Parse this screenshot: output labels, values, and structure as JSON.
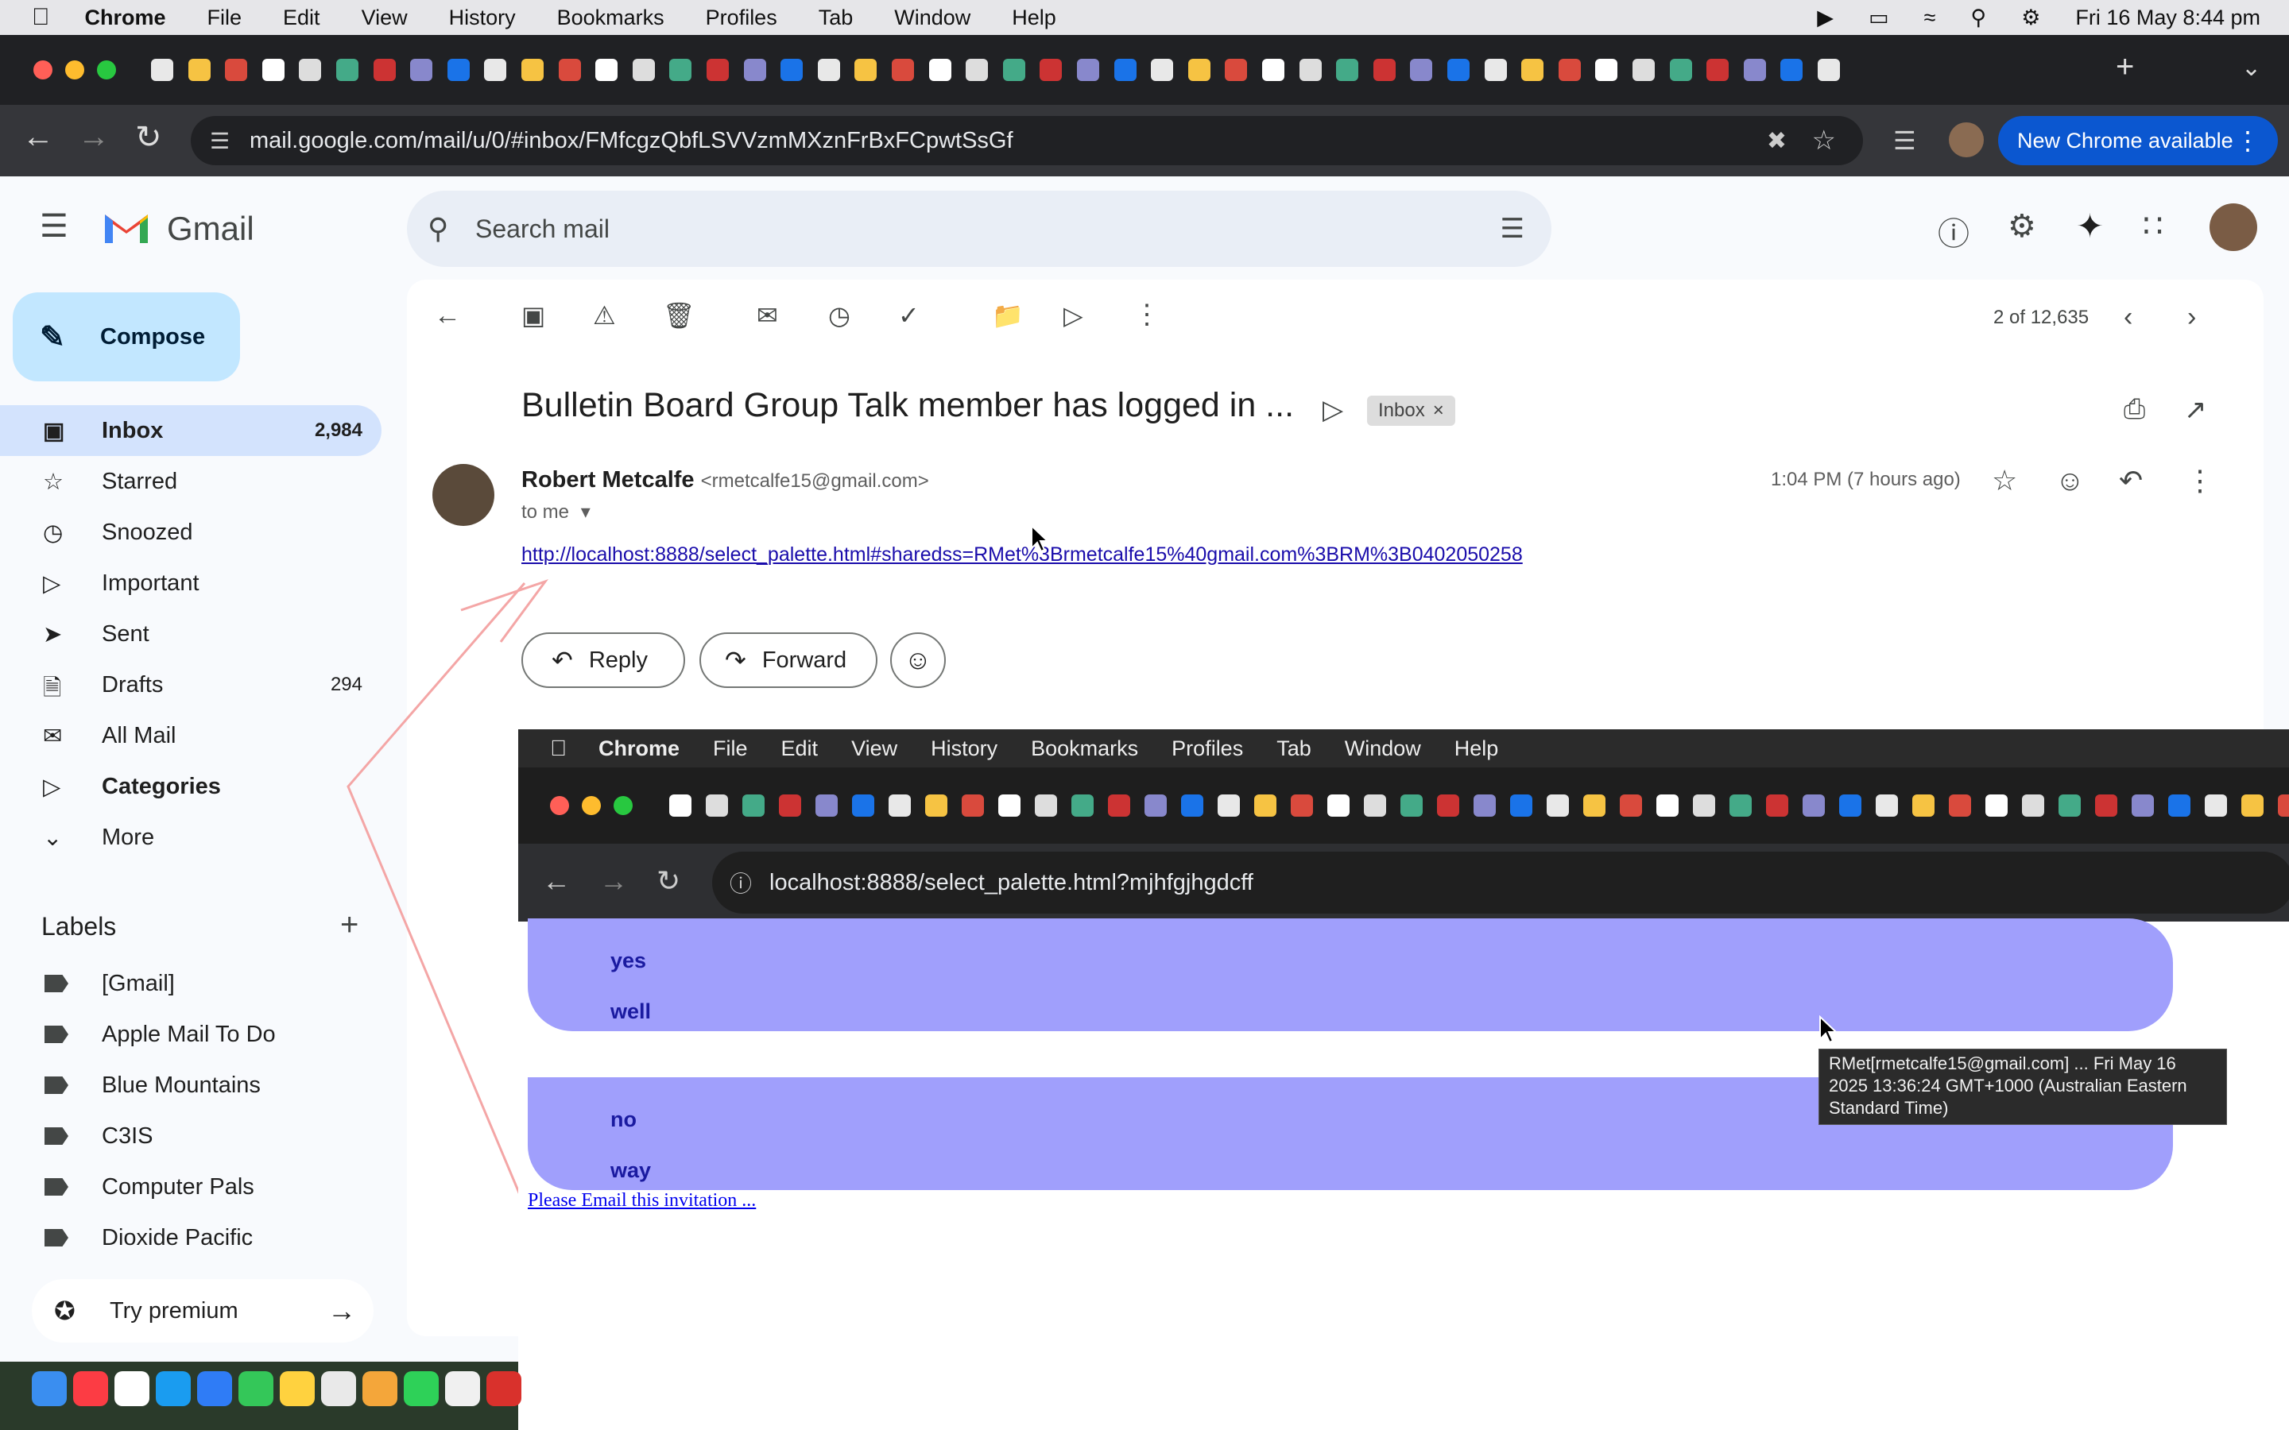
{
  "mac_menu": {
    "app": "Chrome",
    "items": [
      "File",
      "Edit",
      "View",
      "History",
      "Bookmarks",
      "Profiles",
      "Tab",
      "Window",
      "Help"
    ],
    "clock": "Fri 16 May  8:44 pm"
  },
  "browser": {
    "url": "mail.google.com/mail/u/0/#inbox/FMfcgzQbfLSVVzmMXznFrBxFCpwtSsGf",
    "new_chrome": "New Chrome available"
  },
  "gmail": {
    "logo": "Gmail",
    "search_placeholder": "Search mail",
    "compose": "Compose",
    "nav": [
      {
        "label": "Inbox",
        "count": "2,984",
        "icon": "inbox-icon"
      },
      {
        "label": "Starred",
        "count": "",
        "icon": "star-icon"
      },
      {
        "label": "Snoozed",
        "count": "",
        "icon": "clock-icon"
      },
      {
        "label": "Important",
        "count": "",
        "icon": "important-icon"
      },
      {
        "label": "Sent",
        "count": "",
        "icon": "send-icon"
      },
      {
        "label": "Drafts",
        "count": "294",
        "icon": "draft-icon"
      },
      {
        "label": "All Mail",
        "count": "",
        "icon": "all-mail-icon"
      },
      {
        "label": "Categories",
        "count": "",
        "icon": "label-icon"
      },
      {
        "label": "More",
        "count": "",
        "icon": "chevron-down-icon"
      }
    ],
    "labels_heading": "Labels",
    "labels": [
      "[Gmail]",
      "Apple Mail To Do",
      "Blue Mountains",
      "C3IS",
      "Computer Pals",
      "Dioxide Pacific"
    ],
    "try_premium": "Try premium",
    "pager": "2 of 12,635",
    "subject": "Bulletin Board Group Talk member has logged in ...",
    "inbox_chip": "Inbox",
    "sender_name": "Robert Metcalfe",
    "sender_email": "<rmetcalfe15@gmail.com>",
    "to": "to me",
    "time": "1:04 PM (7 hours ago)",
    "link": "http://localhost:8888/select_palette.html#sharedss=RMet%3Brmetcalfe15%40gmail.com%3BRM%3B0402050258",
    "reply": "Reply",
    "forward": "Forward"
  },
  "embedded": {
    "app": "Chrome",
    "menu": [
      "File",
      "Edit",
      "View",
      "History",
      "Bookmarks",
      "Profiles",
      "Tab",
      "Window",
      "Help"
    ],
    "url": "localhost:8888/select_palette.html?mjhfgjhgdcff",
    "bubble1": [
      "yes",
      "well"
    ],
    "bubble2": [
      "no",
      "way"
    ],
    "email_link": "Please Email this invitation ...",
    "tooltip": "RMet[rmetcalfe15@gmail.com] ... Fri May 16 2025 13:36:24 GMT+1000 (Australian Eastern Standard Time)"
  },
  "colors": {
    "inbox_active": "#d3e3fd",
    "compose_bg": "#c2e7ff",
    "bubble": "#a09ffc",
    "chrome_blue": "#0b57d0"
  }
}
